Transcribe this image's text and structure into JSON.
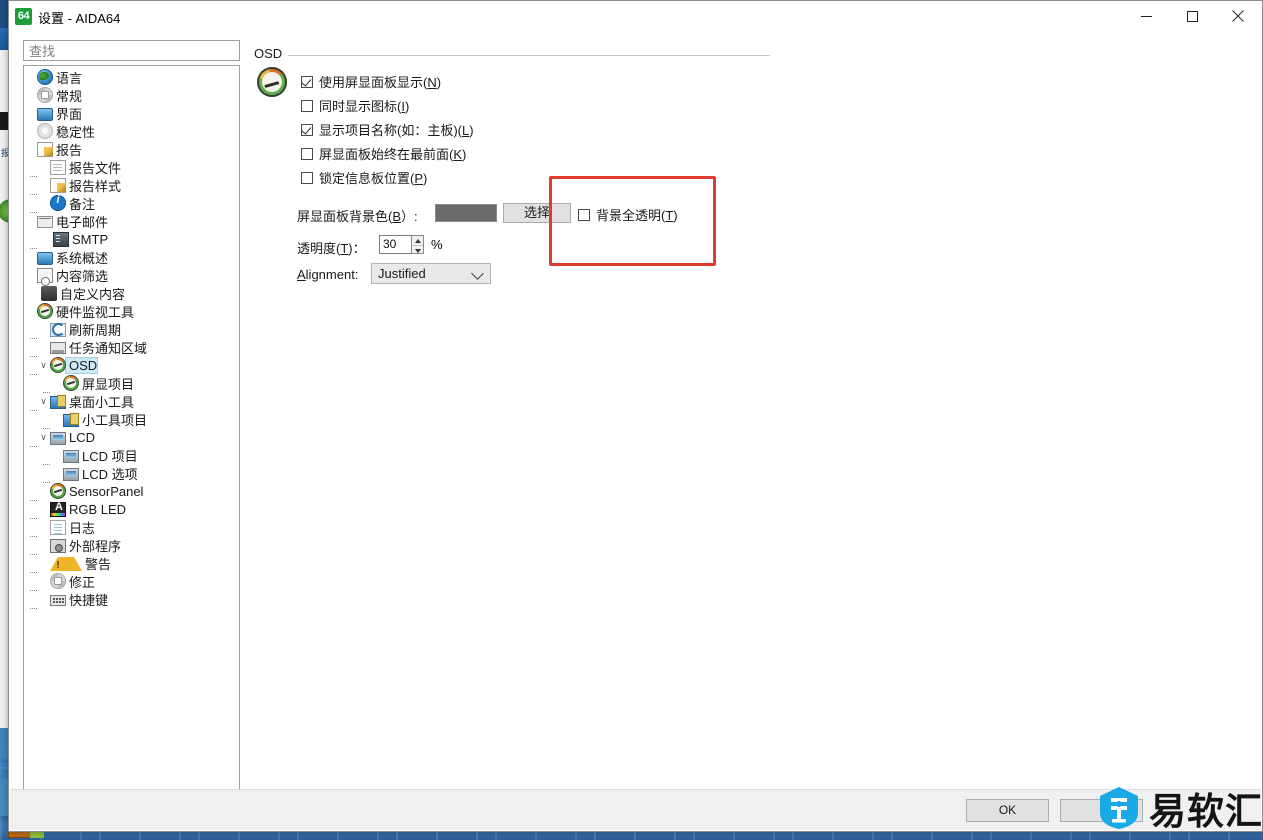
{
  "window": {
    "title": "设置 - AIDA64",
    "app_icon_text": "64",
    "controls": {
      "minimize": "—",
      "maximize": "□",
      "close": "✕"
    }
  },
  "sidebar": {
    "search": {
      "placeholder": "查找",
      "value": ""
    },
    "items": [
      {
        "label": "语言",
        "icon": "globe-icon",
        "depth": 0,
        "expander": "",
        "selected": false
      },
      {
        "label": "常规",
        "icon": "gear-icon",
        "depth": 0,
        "expander": "",
        "selected": false
      },
      {
        "label": "界面",
        "icon": "monitor-icon",
        "depth": 0,
        "expander": "",
        "selected": false
      },
      {
        "label": "稳定性",
        "icon": "gear2-icon",
        "depth": 0,
        "expander": "",
        "selected": false
      },
      {
        "label": "报告",
        "icon": "doc-pen-icon",
        "depth": 0,
        "expander": "",
        "selected": false
      },
      {
        "label": "报告文件",
        "icon": "document-icon",
        "depth": 1,
        "expander": "",
        "selected": false
      },
      {
        "label": "报告样式",
        "icon": "doc-pen-icon",
        "depth": 1,
        "expander": "",
        "selected": false
      },
      {
        "label": "备注",
        "icon": "info-icon",
        "depth": 1,
        "expander": "",
        "selected": false
      },
      {
        "label": "电子邮件",
        "icon": "mail-icon",
        "depth": 0,
        "expander": "",
        "selected": false
      },
      {
        "label": "SMTP",
        "icon": "server-icon",
        "depth": 1,
        "expander": "",
        "selected": false
      },
      {
        "label": "系统概述",
        "icon": "monitor-icon",
        "depth": 0,
        "expander": "",
        "selected": false
      },
      {
        "label": "内容筛选",
        "icon": "filter-icon",
        "depth": 0,
        "expander": "",
        "selected": false
      },
      {
        "label": "自定义内容",
        "icon": "stick-icon",
        "depth": 0,
        "expander": "",
        "selected": false
      },
      {
        "label": "硬件监视工具",
        "icon": "gauge-icon",
        "depth": 0,
        "expander": "",
        "selected": false
      },
      {
        "label": "刷新周期",
        "icon": "refresh-icon",
        "depth": 1,
        "expander": "",
        "selected": false
      },
      {
        "label": "任务通知区域",
        "icon": "tray-icon",
        "depth": 1,
        "expander": "",
        "selected": false
      },
      {
        "label": "OSD",
        "icon": "gauge-icon",
        "depth": 1,
        "expander": "v",
        "selected": true
      },
      {
        "label": "屏显项目",
        "icon": "gauge-icon",
        "depth": 2,
        "expander": "",
        "selected": false
      },
      {
        "label": "桌面小工具",
        "icon": "widget-icon",
        "depth": 1,
        "expander": "v",
        "selected": false
      },
      {
        "label": "小工具项目",
        "icon": "widget-icon",
        "depth": 2,
        "expander": "",
        "selected": false
      },
      {
        "label": "LCD",
        "icon": "lcd-icon",
        "depth": 1,
        "expander": "v",
        "selected": false
      },
      {
        "label": "LCD 项目",
        "icon": "lcd-icon",
        "depth": 2,
        "expander": "",
        "selected": false
      },
      {
        "label": "LCD 选项",
        "icon": "lcd-icon",
        "depth": 2,
        "expander": "",
        "selected": false
      },
      {
        "label": "SensorPanel",
        "icon": "gauge-icon",
        "depth": 1,
        "expander": "",
        "selected": false
      },
      {
        "label": "RGB LED",
        "icon": "rgb-led-icon",
        "depth": 1,
        "expander": "",
        "selected": false
      },
      {
        "label": "日志",
        "icon": "log-icon",
        "depth": 1,
        "expander": "",
        "selected": false
      },
      {
        "label": "外部程序",
        "icon": "external-app-icon",
        "depth": 1,
        "expander": "",
        "selected": false
      },
      {
        "label": "警告",
        "icon": "warning-icon",
        "depth": 1,
        "expander": "",
        "selected": false
      },
      {
        "label": "修正",
        "icon": "gear-icon",
        "depth": 1,
        "expander": "",
        "selected": false
      },
      {
        "label": "快捷键",
        "icon": "keyboard-icon",
        "depth": 1,
        "expander": "",
        "selected": false
      }
    ]
  },
  "main": {
    "group_label": "OSD",
    "group_icon": "osd-gauge-icon",
    "checkboxes": [
      {
        "label": "使用屏显面板显示(N)",
        "text": "使用屏显面板显示(",
        "accel": "N",
        "tail": ")",
        "checked": true
      },
      {
        "label": "同时显示图标(I)",
        "text": "同时显示图标(",
        "accel": "I",
        "tail": ")",
        "checked": false
      },
      {
        "label": "显示项目名称(如：主板)(L)",
        "text": "显示项目名称(如：主板)(",
        "accel": "L",
        "tail": ")",
        "checked": true
      },
      {
        "label": "屏显面板始终在最前面(K)",
        "text": "屏显面板始终在最前面(",
        "accel": "K",
        "tail": ")",
        "checked": false
      },
      {
        "label": "锁定信息板位置(P)",
        "text": "锁定信息板位置(",
        "accel": "P",
        "tail": ")",
        "checked": false
      }
    ],
    "bgcolor": {
      "label_text": "屏显面板背景色(",
      "label_accel": "B",
      "label_tail": "）:",
      "label_full": "屏显面板背景色(B)：",
      "swatch_color": "#6b6b6b",
      "pick_button": "选择"
    },
    "transparency": {
      "label_text": "透明度(",
      "label_accel": "T",
      "label_tail": ")：",
      "value": "30",
      "unit": "%",
      "spinner_up": "▲",
      "spinner_down": "▼"
    },
    "alignment": {
      "label_accel": "A",
      "label_rest": "lignment:",
      "selected": "Justified"
    },
    "full_transparent": {
      "text": "背景全透明(",
      "accel": "T",
      "tail": ")",
      "checked": false
    },
    "highlight_color": "#e03b2f"
  },
  "footer": {
    "ok_label": "OK"
  },
  "watermark": {
    "text": "易软汇",
    "logo_color": "#19a9e6"
  }
}
